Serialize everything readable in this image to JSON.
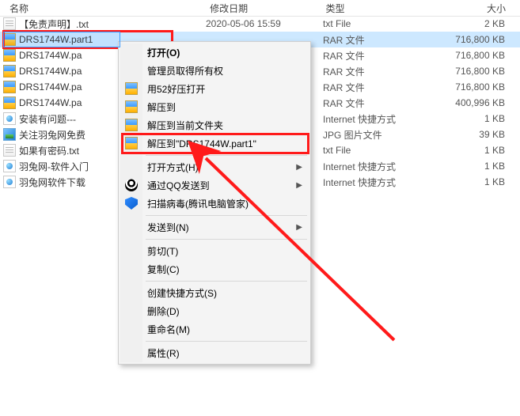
{
  "columns": {
    "name": "名称",
    "date": "修改日期",
    "type": "类型",
    "size": "大小"
  },
  "files": [
    {
      "icon": "txt",
      "name": "【免责声明】.txt",
      "date": "2020-05-06 15:59",
      "type": "txt File",
      "size": "2 KB"
    },
    {
      "icon": "rar",
      "name": "DRS1744W.part1",
      "date": "",
      "type": "RAR 文件",
      "size": "716,800 KB",
      "selected": true
    },
    {
      "icon": "rar",
      "name": "DRS1744W.pa",
      "date": "",
      "type": "RAR 文件",
      "size": "716,800 KB"
    },
    {
      "icon": "rar",
      "name": "DRS1744W.pa",
      "date": "",
      "type": "RAR 文件",
      "size": "716,800 KB"
    },
    {
      "icon": "rar",
      "name": "DRS1744W.pa",
      "date": "",
      "type": "RAR 文件",
      "size": "716,800 KB"
    },
    {
      "icon": "rar",
      "name": "DRS1744W.pa",
      "date": "",
      "type": "RAR 文件",
      "size": "400,996 KB"
    },
    {
      "icon": "url",
      "name": "安装有问题---",
      "date": "",
      "type": "Internet 快捷方式",
      "size": "1 KB"
    },
    {
      "icon": "jpg",
      "name": "关注羽兔网免费",
      "date": "",
      "type": "JPG 图片文件",
      "size": "39 KB"
    },
    {
      "icon": "txt",
      "name": "如果有密码.txt",
      "date": "",
      "type": "txt File",
      "size": "1 KB"
    },
    {
      "icon": "url",
      "name": "羽兔网-软件入门",
      "date": "",
      "type": "Internet 快捷方式",
      "size": "1 KB"
    },
    {
      "icon": "url",
      "name": "羽兔网软件下载",
      "date": "",
      "type": "Internet 快捷方式",
      "size": "1 KB"
    }
  ],
  "menu": {
    "open": "打开(O)",
    "admin": "管理员取得所有权",
    "open52": "用52好压打开",
    "extract_to": "解压到",
    "extract_here": "解压到当前文件夹",
    "extract_name": "解压到\"DRS1744W.part1\"",
    "open_with": "打开方式(H)",
    "send_qq": "通过QQ发送到",
    "scan": "扫描病毒(腾讯电脑管家)",
    "send_to": "发送到(N)",
    "cut": "剪切(T)",
    "copy": "复制(C)",
    "shortcut": "创建快捷方式(S)",
    "delete": "删除(D)",
    "rename": "重命名(M)",
    "properties": "属性(R)"
  }
}
